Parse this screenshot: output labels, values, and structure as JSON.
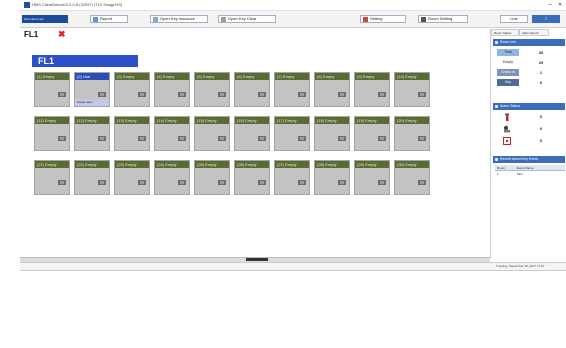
{
  "window": {
    "title": "HMS ClientDeluxe/3.0.0.8 (32/NT) (T10 Svsgp/HS)",
    "minimize": "–",
    "close": "✕"
  },
  "toolbar": {
    "logo_text": "hms.client.com",
    "report_label": "Report",
    "open_issue_label": "Open Key Issuance",
    "close_issue_label": "Open Key Clear",
    "setting_label": "Setting",
    "room_setting_label": "Room Setting",
    "link1": "Link",
    "link2": "?"
  },
  "tab": {
    "name": "FL1",
    "close": "✖"
  },
  "floor_label": "FL1",
  "rooms": [
    [
      "(1) Empty",
      "(2) Use",
      "(3) Empty",
      "(4) Empty",
      "(5) Empty",
      "(6) Empty",
      "(7) Empty",
      "(8) Empty",
      "(9) Empty",
      "(10) Empty"
    ],
    [
      "(11) Empty",
      "(12) Empty",
      "(13) Empty",
      "(14) Empty",
      "(15) Empty",
      "(16) Empty",
      "(17) Empty",
      "(18) Empty",
      "(19) Empty",
      "(20) Empty"
    ],
    [
      "(21) Empty",
      "(22) Empty",
      "(23) Empty",
      "(24) Empty",
      "(25) Empty",
      "(26) Empty",
      "(27) Empty",
      "(28) Empty",
      "(29) Empty",
      "(30) Empty"
    ]
  ],
  "active_room_badge": "Guest room",
  "side": {
    "tabs": [
      "Room Status",
      "Alarm Event"
    ],
    "room_info": {
      "title": "Room Info",
      "rows": [
        {
          "label": "Total",
          "value": "30"
        },
        {
          "label": "Empty",
          "value": "29"
        },
        {
          "label": "Check In",
          "value": "1"
        },
        {
          "label": "Key",
          "value": "0"
        }
      ]
    },
    "alarm_status": {
      "title": "Alarm Status",
      "rows": [
        {
          "icon": "fire-extinguisher-icon",
          "value": "0"
        },
        {
          "icon": "sos-alarm-icon",
          "value": "0"
        },
        {
          "icon": "door-alarm-icon",
          "value": "0"
        }
      ]
    },
    "recent": {
      "title": "Recent Alarm/Key Event",
      "columns": [
        "Room",
        "Event Name"
      ],
      "rows": [
        [
          "1",
          "KEY"
        ]
      ]
    }
  },
  "status": {
    "datetime": "Tuesday, September 18, 2017 17:07"
  },
  "colors": {
    "header_green": "#5a6b35",
    "room_gray": "#c3c3c3",
    "accent_blue": "#2d4fc9",
    "panel_blue": "#3a6dba"
  }
}
